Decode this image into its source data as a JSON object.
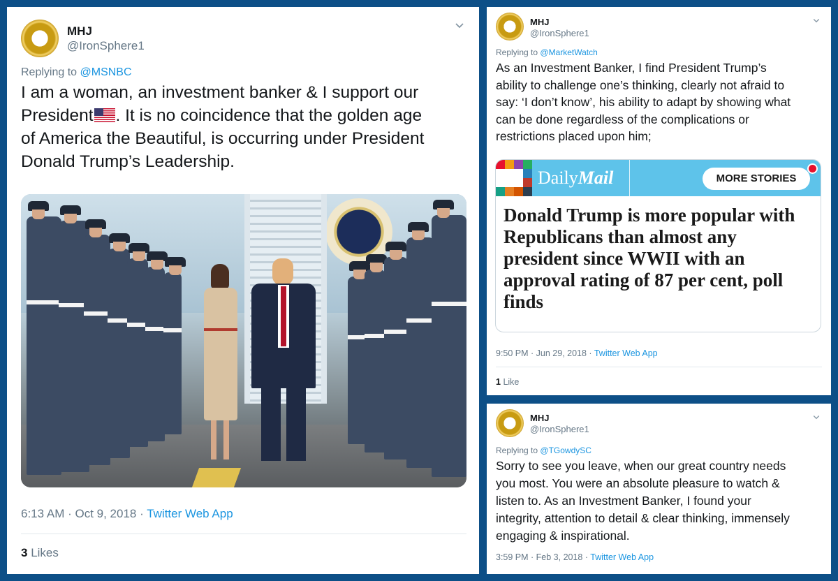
{
  "tweet_main": {
    "name": "MHJ",
    "handle": "@IronSphere1",
    "reply_prefix": "Replying to",
    "reply_to": "@MSNBC",
    "text_line1": "I am a woman, an investment banker & I support our",
    "text_line2a": "President",
    "flag": "🇺🇸",
    "text_line2b": ".  It is no coincidence that the golden age",
    "text_line3": "of America the Beautiful, is occurring under President",
    "text_line4": "Donald Trump’s Leadership.",
    "time": "6:13 AM · Oct 9, 2018 ·",
    "source": "Twitter Web App",
    "likes_count": "3",
    "likes_label": "Likes"
  },
  "tweet_top_right": {
    "name": "MHJ",
    "handle": "@IronSphere1",
    "reply_prefix": "Replying to",
    "reply_to": "@MarketWatch",
    "lines": [
      "As an Investment Banker, I find President Trump’s",
      "ability to challenge one’s thinking, clearly not afraid to",
      "say: ‘I don’t know’, his ability to adapt by showing what",
      "can be done regardless of the complications or",
      "restrictions placed upon him;"
    ],
    "card": {
      "brand_plain": "Daily",
      "brand_bold": "Mail",
      "more_label": "MORE STORIES",
      "headline_lines": [
        "Donald Trump is more popular with",
        "Republicans than almost any",
        "president since WWII with an",
        "approval rating of 87 per cent, poll",
        "finds"
      ]
    },
    "time": "9:50 PM · Jun 29, 2018 ·",
    "source": "Twitter Web App",
    "likes_count": "1",
    "likes_label": "Like"
  },
  "tweet_bottom_right": {
    "name": "MHJ",
    "handle": "@IronSphere1",
    "reply_prefix": "Replying to",
    "reply_to": "@TGowdySC",
    "lines": [
      "Sorry to see you leave, when our great country needs",
      "you most. You were an absolute pleasure to watch &",
      "listen to. As an Investment Banker, I found your",
      "integrity, attention to detail & clear thinking, immensely",
      "engaging & inspirational."
    ],
    "time": "3:59 PM · Feb 3, 2018 ·",
    "source": "Twitter Web App"
  },
  "colors": {
    "background": "#0d4f87",
    "link": "#1b95e0",
    "muted": "#657786",
    "dm_blue": "#5ec3ea",
    "red_dot": "#e8112d"
  },
  "icons": {
    "menu": "chevron-down-icon",
    "avatar": "gold-ring-avatar"
  }
}
